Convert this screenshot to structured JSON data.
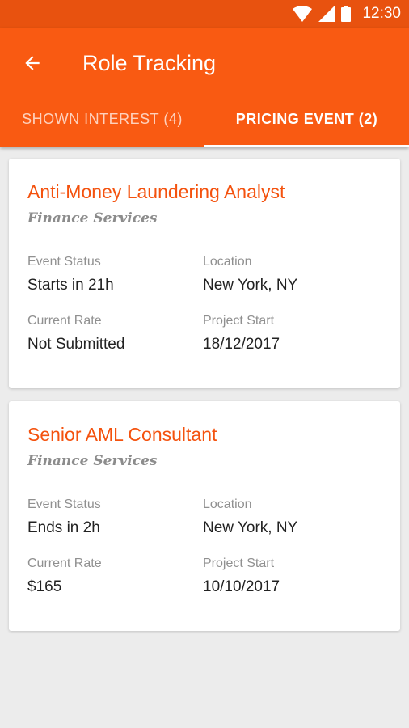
{
  "status_bar": {
    "time": "12:30",
    "icons": [
      "wifi-icon",
      "signal-icon",
      "battery-icon"
    ]
  },
  "app_bar": {
    "title": "Role Tracking",
    "back_icon": "arrow-back-icon",
    "tabs": [
      {
        "label": "SHOWN INTEREST (4)",
        "active": false
      },
      {
        "label": "PRICING EVENT (2)",
        "active": true
      }
    ]
  },
  "colors": {
    "primary": "#f95a12",
    "status_bar": "#e8520f",
    "accent_title": "#f4520e",
    "background": "#ececec"
  },
  "cards": [
    {
      "title": "Anti-Money Laundering Analyst",
      "subtitle": "Finance Services",
      "fields": [
        {
          "label": "Event Status",
          "value": "Starts in 21h"
        },
        {
          "label": "Location",
          "value": "New York, NY"
        },
        {
          "label": "Current Rate",
          "value": "Not Submitted"
        },
        {
          "label": "Project Start",
          "value": "18/12/2017"
        }
      ]
    },
    {
      "title": "Senior AML Consultant",
      "subtitle": "Finance Services",
      "fields": [
        {
          "label": "Event Status",
          "value": "Ends in 2h"
        },
        {
          "label": "Location",
          "value": "New York, NY"
        },
        {
          "label": "Current Rate",
          "value": "$165"
        },
        {
          "label": "Project Start",
          "value": "10/10/2017"
        }
      ]
    }
  ]
}
